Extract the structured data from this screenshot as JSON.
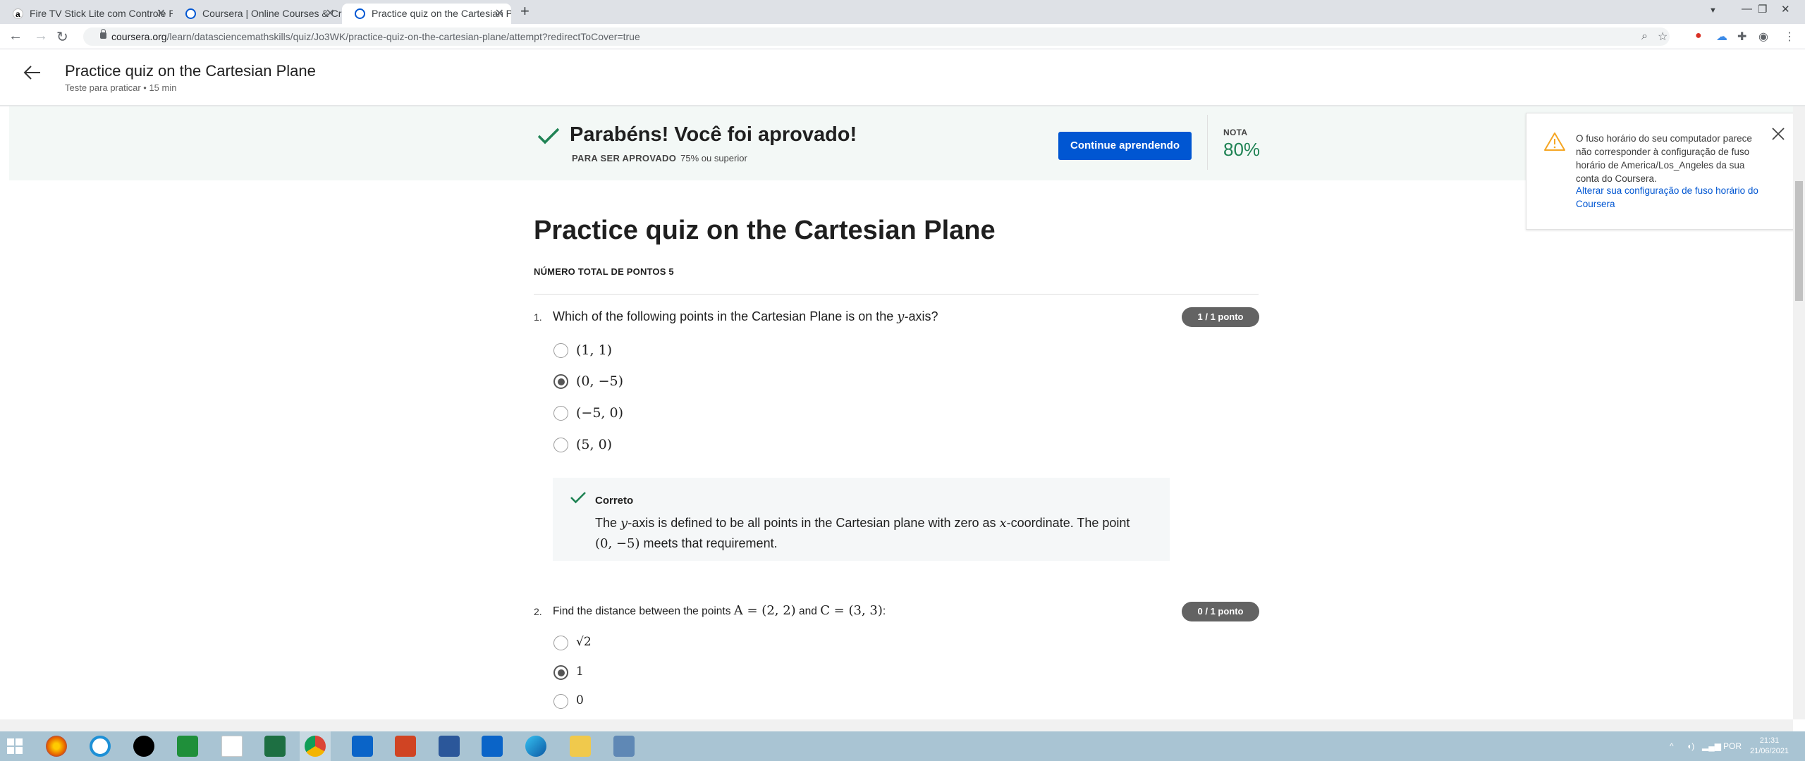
{
  "browser": {
    "tabs": [
      {
        "title": "Fire TV Stick Lite com Controle R",
        "favicon": "amazon-icon"
      },
      {
        "title": "Coursera | Online Courses & Cre",
        "favicon": "coursera-icon"
      },
      {
        "title": "Practice quiz on the Cartesian Pl",
        "favicon": "coursera-icon",
        "active": true
      }
    ],
    "url_host": "coursera.org",
    "url_path": "/learn/datasciencemathskills/quiz/Jo3WK/practice-quiz-on-the-cartesian-plane/attempt?redirectToCover=true"
  },
  "header": {
    "title": "Practice quiz on the Cartesian Plane",
    "subtitle": "Teste para praticar • 15 min"
  },
  "banner": {
    "congrats": "Parabéns! Você foi aprovado!",
    "pass_label": "PARA SER APROVADO",
    "pass_value": "75% ou superior",
    "continue_label": "Continue aprendendo",
    "grade_label": "NOTA",
    "grade_value": "80%"
  },
  "notice": {
    "text": "O fuso horário do seu computador parece não corresponder à configuração de fuso horário de America/Los_Angeles da sua conta do Coursera.",
    "link": "Alterar sua configuração de fuso horário do Coursera"
  },
  "quiz": {
    "title": "Practice quiz on the Cartesian Plane",
    "total_points": "NÚMERO TOTAL DE PONTOS 5",
    "questions": [
      {
        "number": "1.",
        "text_pre": "Which of the following points in the Cartesian Plane is on the ",
        "text_math": "y",
        "text_post": "-axis?",
        "points": "1 / 1 ponto",
        "options": [
          "(1, 1)",
          "(0, −5)",
          "(−5, 0)",
          "(5, 0)"
        ],
        "selected_index": 1,
        "feedback": {
          "title": "Correto",
          "line1_pre": "The ",
          "line1_math1": "y",
          "line1_mid": "-axis is defined to be all points in the Cartesian plane with zero as ",
          "line1_math2": "x",
          "line1_post": "-coordinate. The point",
          "line2_math": "(0, −5)",
          "line2_post": " meets that requirement."
        }
      },
      {
        "number": "2.",
        "text_pre": "Find the distance between the points ",
        "text_math1": "A = (2, 2)",
        "text_mid": " and ",
        "text_math2": "C = (3, 3)",
        "text_post": ":",
        "points": "0 / 1 ponto",
        "options": [
          "√2",
          "1",
          "0"
        ],
        "selected_index": 1
      }
    ]
  },
  "taskbar": {
    "language": "POR",
    "time": "21:31",
    "date": "21/06/2021"
  }
}
